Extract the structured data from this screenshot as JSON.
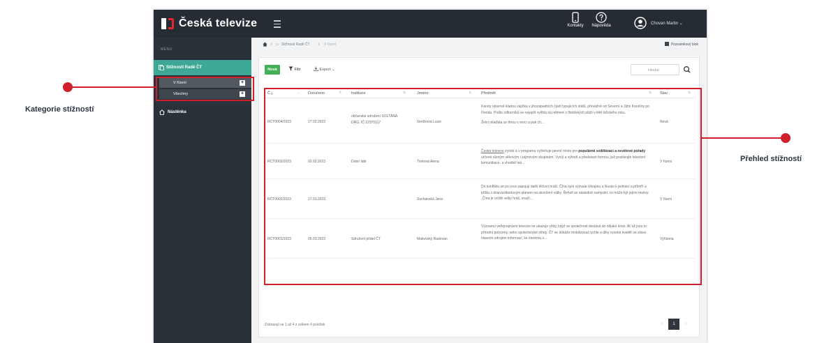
{
  "brand": {
    "name": "Česká televize"
  },
  "topbar": {
    "contacts_label": "Kontakty",
    "help_label": "Nápověda",
    "user_name": "Chovan Martin"
  },
  "sidebar": {
    "caption": "MENU",
    "active_label": "Stížnosti Radě ČT",
    "sub_items": [
      {
        "label": "V řízení"
      },
      {
        "label": "Všechny"
      }
    ],
    "dashboard_label": "Nástěnka"
  },
  "breadcrumb": {
    "section": "Stížnosti Radě ČT",
    "current": "V řízení",
    "notes_label": "Poznámkový blok"
  },
  "toolbar": {
    "new_label": "Nová",
    "filter_label": "Filtr",
    "export_label": "Export",
    "search_placeholder": "Hledat"
  },
  "table": {
    "columns": [
      "Č.j.",
      "Doručeno",
      "Instituce",
      "Jméno",
      "Předmět",
      "Stav"
    ],
    "rows": [
      {
        "cj": "RCT0004/2023",
        "date": "27.02.2023",
        "institution": "občanské sdružení SOLTÁNA DRG, IČ 22970117",
        "name": "Veričková Lucie",
        "subject_1": "Karety observé kladou vajíčka v jihozápadních částí typujících států, převážně od Severní a Jižní Karolíny po Floridu. Podle odborníků se nejspíš vylíhla na některé z floridských pláží v létě loňského roku.",
        "subject_2": "Želví mláďata se throu v moci a pak ch...",
        "status": "Nová"
      },
      {
        "cj": "RCT0003/2023",
        "date": "02.02.2023",
        "institution": "Dobrí lidé",
        "name": "Trnková Alena",
        "subject_link": "Česká televize",
        "subject_mid": " vyrobí a v programu vyčleňuje pevné místo pro ",
        "subject_bold": "populárně vzdělávací a osvětové pořady",
        "subject_end": " určené různým věkovým i zájmovým skupinám. Vyvíjí a výhodí a představit formou, jež pozitivujte televizní komunikace, a vhodně tak...",
        "status": "V řízení"
      },
      {
        "cj": "RCT0002/2023",
        "date": "17.01.2023",
        "institution": "",
        "name": "Suchánská Jana",
        "subject": "Do konfliktu se po roce zapojují další klíčoví hráči. Čína nyní vyzvala Ukrajinu a Rusko k jednání a přímíří a přišla s dvanáctibodovým plánem na skončení války. Řeholl se následně zamyslel, co může být jejími motivy. „Čína je určitě velký hráč, snaží...",
        "status": "V řízení"
      },
      {
        "cj": "RCT0001/2023",
        "date": "05.01.2023",
        "institution": "Sdružení přátel ČT",
        "name": "Makovský Radovan",
        "subject": "Významu veřejnoprávní televize se ukazuje vždy, když se společnost dostává do nějaké krize. Ať už jsou to přírodní pohromy, nebo společenské střety. ČT se dokáže mobilizovat rychle a díky vysoké kvalitě se stává hlavním zdrojem informací, ke kterému s...",
        "status": "Vyřízena"
      }
    ]
  },
  "pagination": {
    "summary": "Zobrazují se 1 až 4 z celkem 4 položek",
    "prev": "‹",
    "page": "1",
    "next": "›"
  },
  "callouts": {
    "categories": "Kategorie stížností",
    "overview": "Přehled stížností"
  },
  "colors": {
    "accent": "#3fa796",
    "highlight": "#d11f2b",
    "new_button": "#45b058",
    "topbar": "#262c33"
  }
}
